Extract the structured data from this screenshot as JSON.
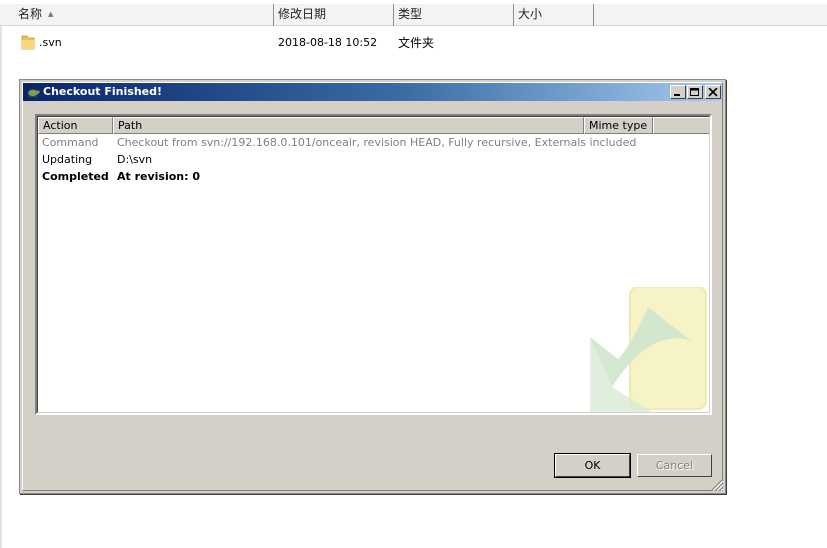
{
  "explorer": {
    "columns": [
      {
        "label": "名称",
        "sorted": true
      },
      {
        "label": "修改日期"
      },
      {
        "label": "类型"
      },
      {
        "label": "大小"
      }
    ],
    "files": [
      {
        "name": ".svn",
        "modified": "2018-08-18 10:52",
        "type": "文件夹",
        "icon": "folder-icon"
      }
    ]
  },
  "dialog": {
    "title": "Checkout Finished!",
    "title_icon": "tortoise-icon",
    "columns": {
      "action": "Action",
      "path": "Path",
      "mime": "Mime type"
    },
    "rows": [
      {
        "action": "Command",
        "path": "Checkout from svn://192.168.0.101/onceair, revision HEAD, Fully recursive, Externals included",
        "style": "gray"
      },
      {
        "action": "Updating",
        "path": "D:\\svn",
        "style": "normal"
      },
      {
        "action": "Completed",
        "path": "At revision: 0",
        "style": "bold"
      }
    ],
    "buttons": {
      "ok": "OK",
      "cancel": "Cancel"
    },
    "colors": {
      "title_start": "#0a246a",
      "title_end": "#a6caf0",
      "face": "#d4d0c8"
    }
  }
}
